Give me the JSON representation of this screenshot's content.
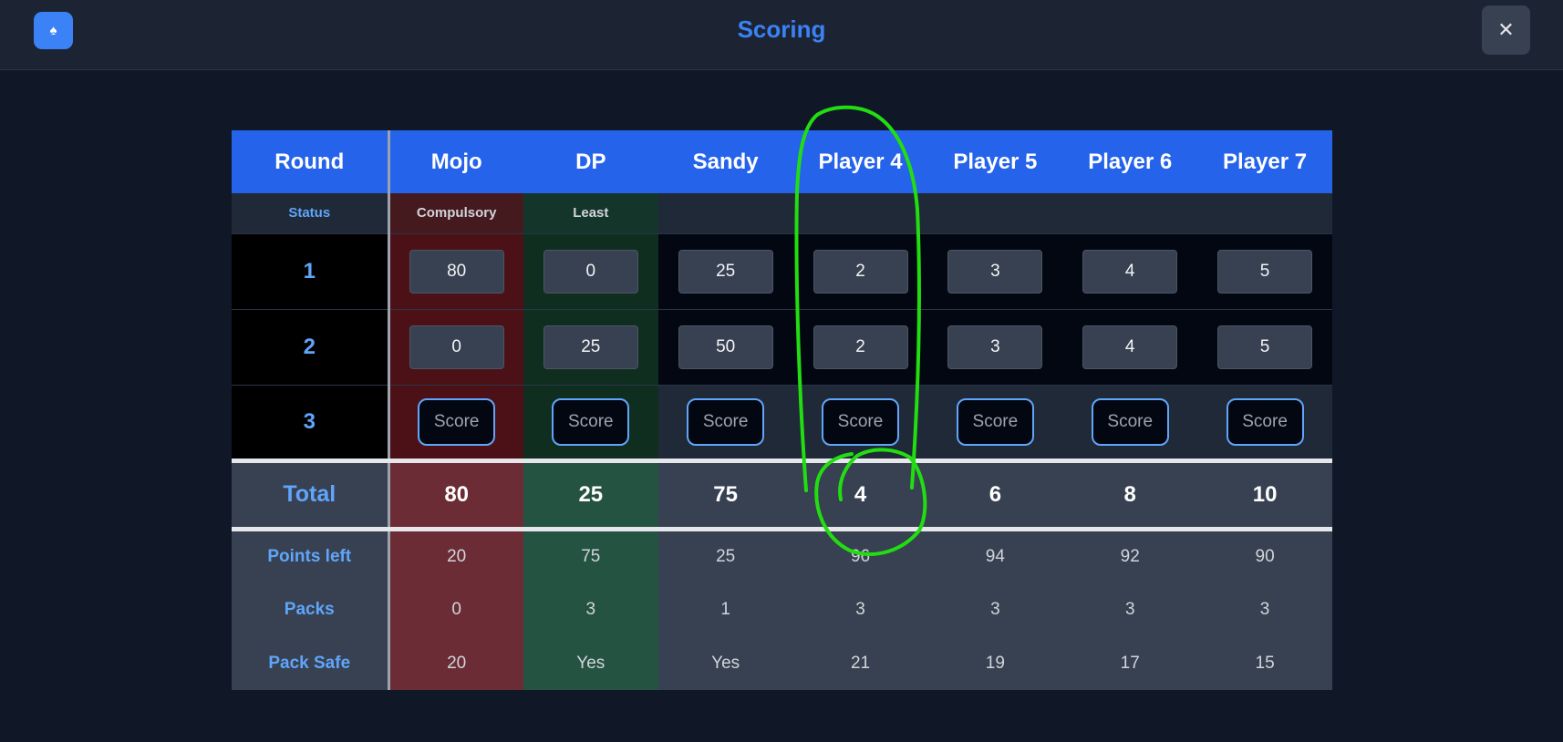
{
  "header": {
    "title": "Scoring",
    "app_icon": "♠",
    "close_icon": "✕"
  },
  "table": {
    "round_header": "Round",
    "players": [
      "Mojo",
      "DP",
      "Sandy",
      "Player 4",
      "Player 5",
      "Player 6",
      "Player 7"
    ],
    "status_label": "Status",
    "status": [
      "Compulsory",
      "Least",
      "",
      "",
      "",
      "",
      ""
    ],
    "rounds": [
      {
        "label": "1",
        "values": [
          "80",
          "0",
          "25",
          "2",
          "3",
          "4",
          "5"
        ]
      },
      {
        "label": "2",
        "values": [
          "0",
          "25",
          "50",
          "2",
          "3",
          "4",
          "5"
        ]
      }
    ],
    "current_round": {
      "label": "3",
      "button_label": "Score"
    },
    "total": {
      "label": "Total",
      "values": [
        "80",
        "25",
        "75",
        "4",
        "6",
        "8",
        "10"
      ]
    },
    "stats": [
      {
        "label": "Points left",
        "values": [
          "20",
          "75",
          "25",
          "96",
          "94",
          "92",
          "90"
        ]
      },
      {
        "label": "Packs",
        "values": [
          "0",
          "3",
          "1",
          "3",
          "3",
          "3",
          "3"
        ]
      },
      {
        "label": "Pack Safe",
        "values": [
          "20",
          "Yes",
          "Yes",
          "21",
          "19",
          "17",
          "15"
        ]
      }
    ]
  },
  "colors": {
    "accent": "#2563eb",
    "title": "#3b82f6",
    "compulsory_column": "#6b2c35",
    "least_column": "#255342",
    "annotation": "#22dd11"
  }
}
